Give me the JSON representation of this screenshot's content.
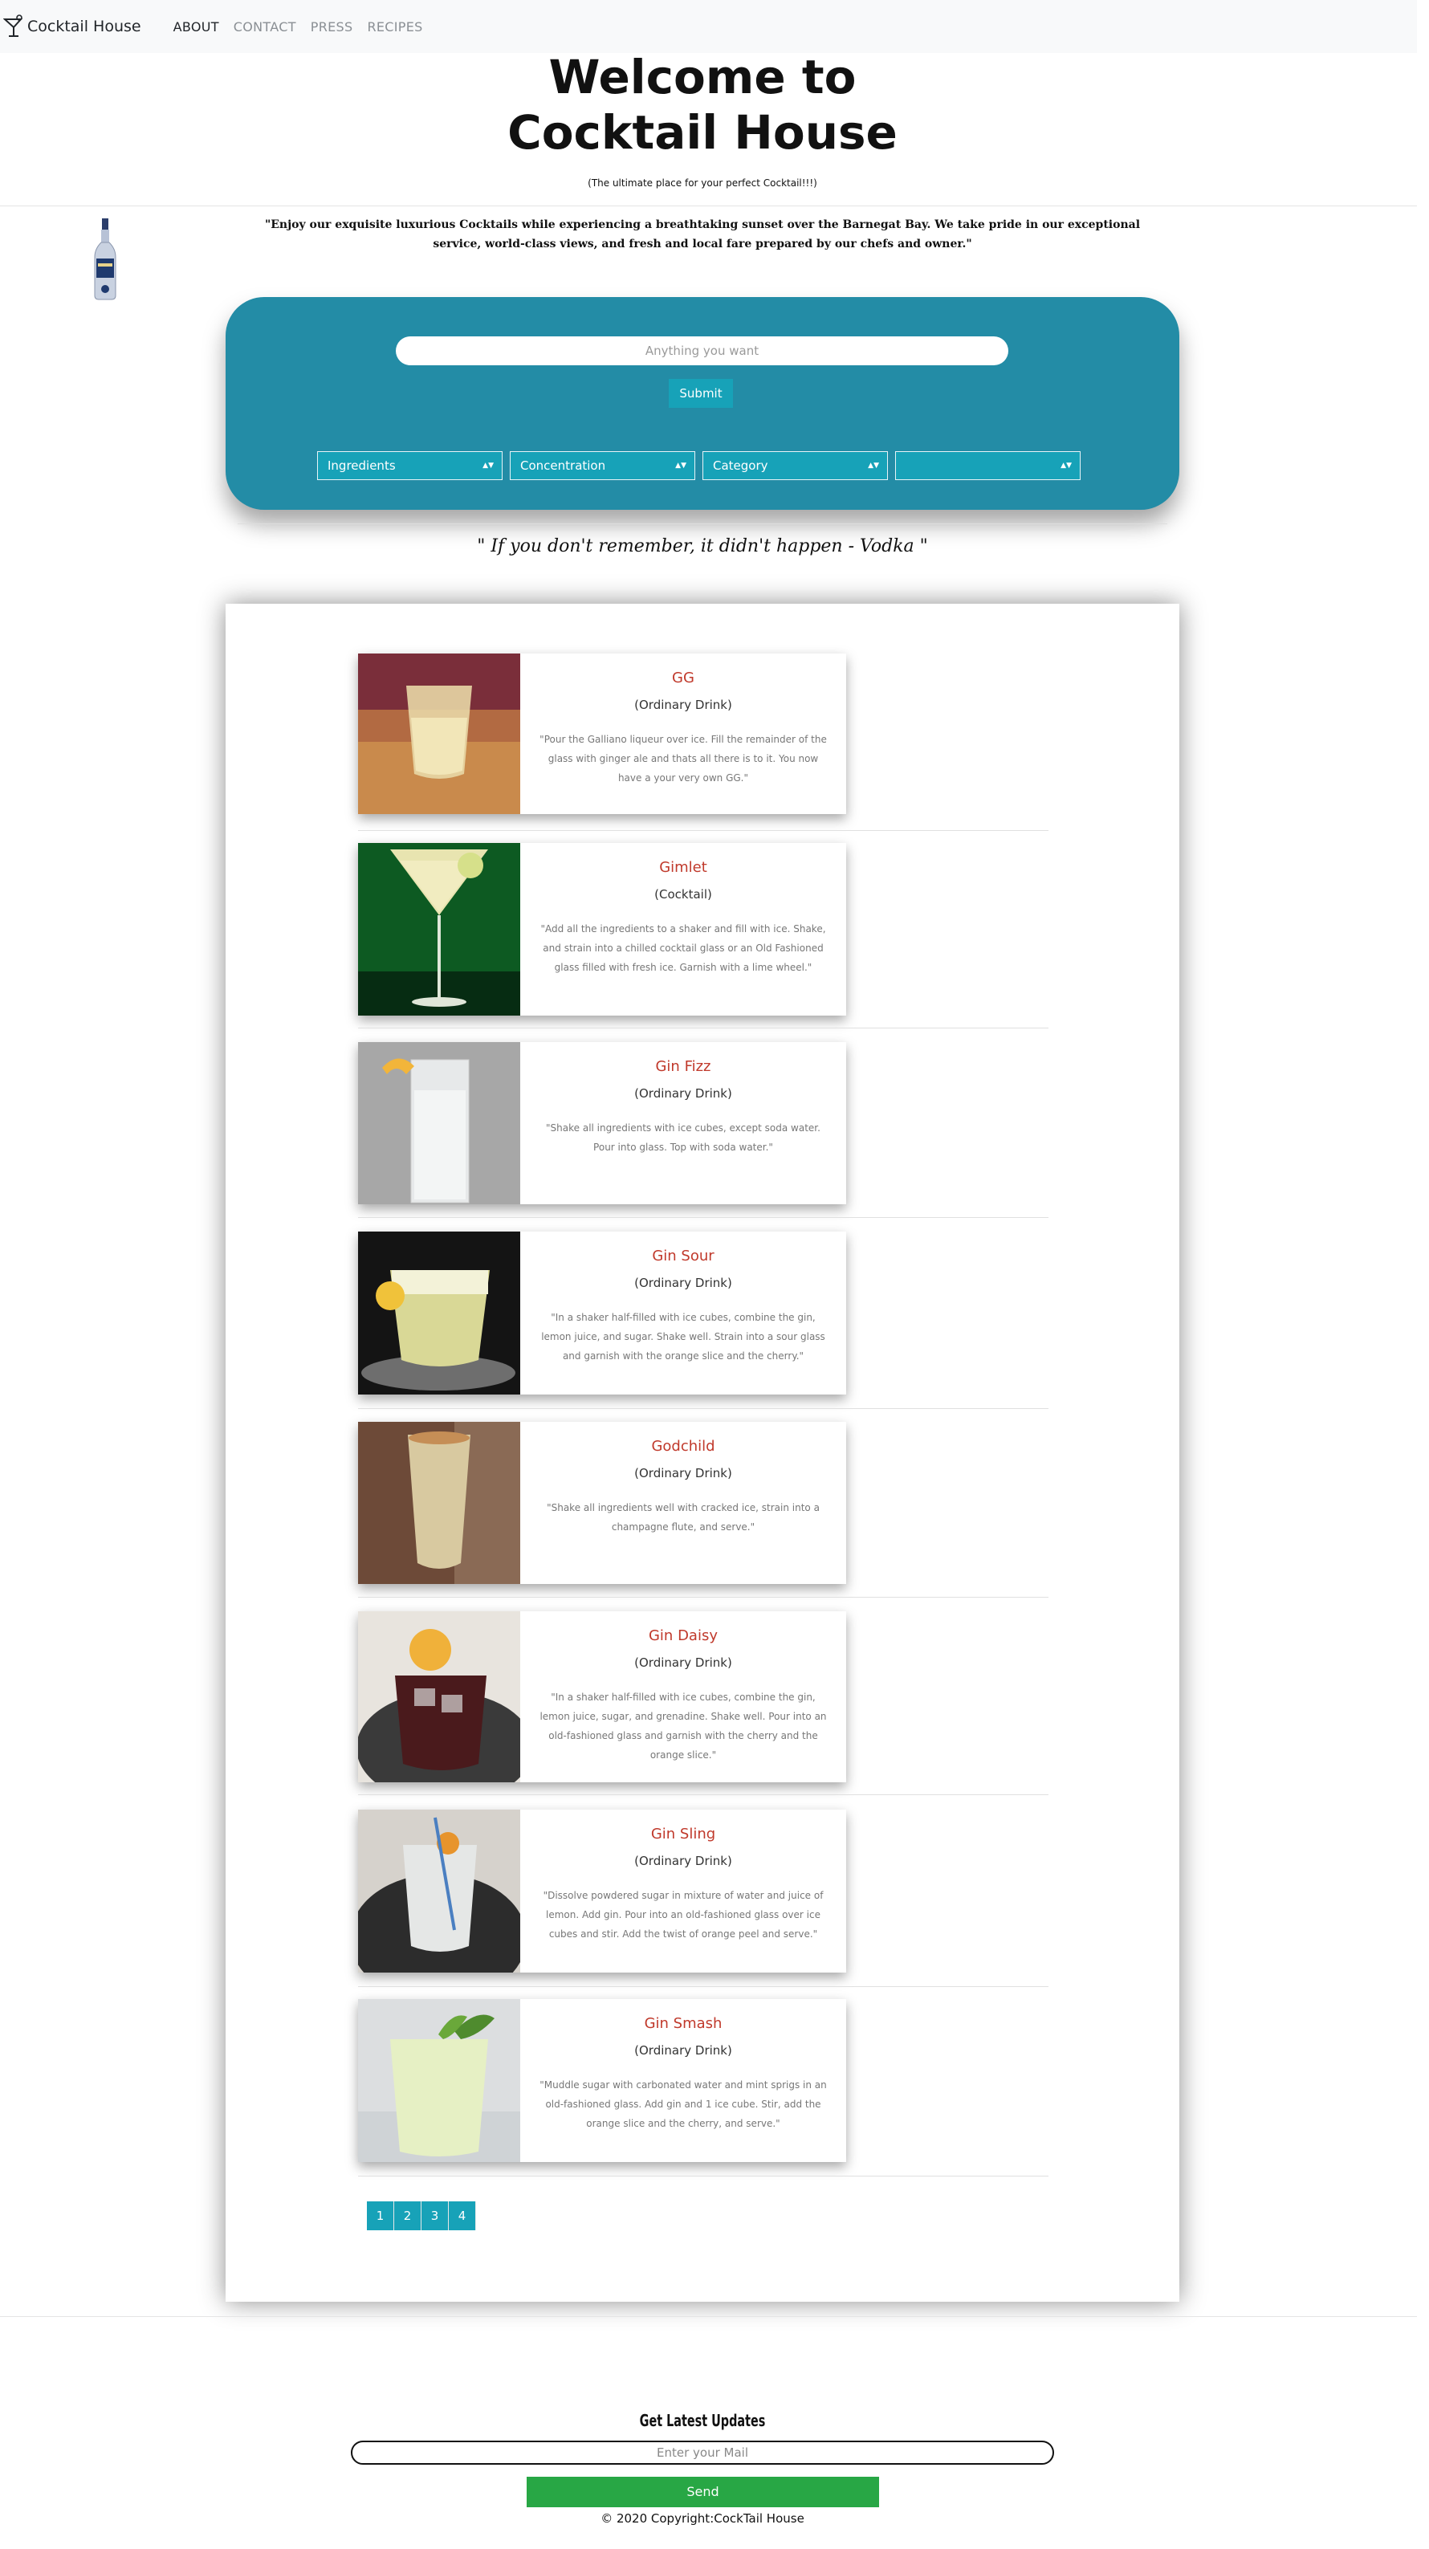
{
  "navbar": {
    "brand": "Cocktail House",
    "links": [
      "ABOUT",
      "CONTACT",
      "PRESS",
      "RECIPES"
    ]
  },
  "hero": {
    "title_line1": "Welcome to",
    "title_line2": "Cocktail House",
    "subtitle": "(The ultimate place for your perfect Cocktail!!!)",
    "intro": "\"Enjoy our exquisite luxurious Cocktails while experiencing a breathtaking sunset over the Barnegat Bay. We take pride in our exceptional service, world-class views, and fresh and local fare prepared by our chefs and owner.\""
  },
  "search": {
    "placeholder": "Anything you want",
    "submit_label": "Submit",
    "filters": [
      "Ingredients",
      "Concentration",
      "Category",
      ""
    ]
  },
  "quote": "\" If you don't remember, it didn't happen - Vodka \"",
  "cocktails": [
    {
      "name": "GG",
      "category": "(Ordinary Drink)",
      "description": "\"Pour the Galliano liqueur over ice. Fill the remainder of the glass with ginger ale and thats all there is to it. You now have a your very own GG.\""
    },
    {
      "name": "Gimlet",
      "category": "(Cocktail)",
      "description": "\"Add all the ingredients to a shaker and fill with ice. Shake, and strain into a chilled cocktail glass or an Old Fashioned glass filled with fresh ice. Garnish with a lime wheel.\""
    },
    {
      "name": "Gin Fizz",
      "category": "(Ordinary Drink)",
      "description": "\"Shake all ingredients with ice cubes, except soda water. Pour into glass. Top with soda water.\""
    },
    {
      "name": "Gin Sour",
      "category": "(Ordinary Drink)",
      "description": "\"In a shaker half-filled with ice cubes, combine the gin, lemon juice, and sugar. Shake well. Strain into a sour glass and garnish with the orange slice and the cherry.\""
    },
    {
      "name": "Godchild",
      "category": "(Ordinary Drink)",
      "description": "\"Shake all ingredients well with cracked ice, strain into a champagne flute, and serve.\""
    },
    {
      "name": "Gin Daisy",
      "category": "(Ordinary Drink)",
      "description": "\"In a shaker half-filled with ice cubes, combine the gin, lemon juice, sugar, and grenadine. Shake well. Pour into an old-fashioned glass and garnish with the cherry and the orange slice.\""
    },
    {
      "name": "Gin Sling",
      "category": "(Ordinary Drink)",
      "description": "\"Dissolve powdered sugar in mixture of water and juice of lemon. Add gin. Pour into an old-fashioned glass over ice cubes and stir. Add the twist of orange peel and serve.\""
    },
    {
      "name": "Gin Smash",
      "category": "(Ordinary Drink)",
      "description": "\"Muddle sugar with carbonated water and mint sprigs in an old-fashioned glass. Add gin and 1 ice cube. Stir, add the orange slice and the cherry, and serve.\""
    }
  ],
  "pagination": [
    "1",
    "2",
    "3",
    "4"
  ],
  "footer": {
    "updates_title": "Get Latest Updates",
    "mail_placeholder": "Enter your Mail",
    "send_label": "Send",
    "copyright": "© 2020 Copyright:CockTail House"
  },
  "colors": {
    "panel": "#238ca6",
    "accent": "#17a2b8",
    "send": "#28a745",
    "cocktail_name": "#c0392b"
  }
}
